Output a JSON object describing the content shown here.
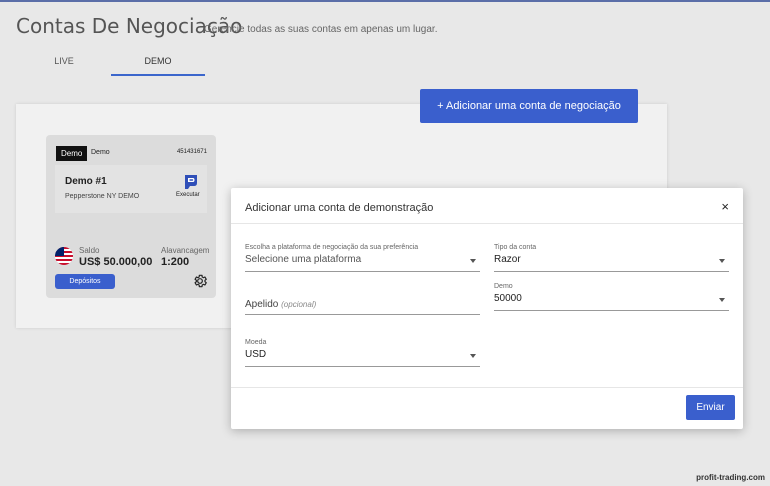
{
  "header": {
    "title": "Contas De Negociação",
    "subtitle": "Gerencie todas as suas contas em apenas um lugar."
  },
  "tabs": [
    {
      "label": "LIVE",
      "active": false
    },
    {
      "label": "DEMO",
      "active": true
    }
  ],
  "add_account_button": {
    "icon": "plus-icon",
    "label": "+ Adicionar uma conta de negociação"
  },
  "account_card": {
    "badge": "Demo",
    "type": "Demo",
    "number": "451431671",
    "name": "Demo #1",
    "server": "Pepperstone NY DEMO",
    "platform_logo": "platform-p-logo",
    "execute_label": "Executar",
    "balance_label": "Saldo",
    "balance_value": "US$ 50.000,00",
    "leverage_label": "Alavancagem",
    "leverage_value": "1:200",
    "deposit_button": "Depósitos",
    "flag": "us-flag-icon",
    "settings_icon": "gear-icon"
  },
  "modal": {
    "title": "Adicionar uma conta de demonstração",
    "close_icon": "close-icon",
    "close_glyph": "×",
    "platform": {
      "label": "Escolha a plataforma de negociação da sua preferência",
      "value": "Selecione uma plataforma"
    },
    "account_type": {
      "label": "Tipo da conta",
      "value": "Razor"
    },
    "nickname": {
      "label": "Apelido",
      "optional": "(opcional)"
    },
    "demo_amount": {
      "label": "Demo",
      "value": "50000"
    },
    "currency": {
      "label": "Moeda",
      "value": "USD"
    },
    "submit_label": "Enviar"
  },
  "watermark": "profit-trading.com",
  "colors": {
    "accent": "#3a5fcd",
    "background": "#e8e8e8"
  }
}
